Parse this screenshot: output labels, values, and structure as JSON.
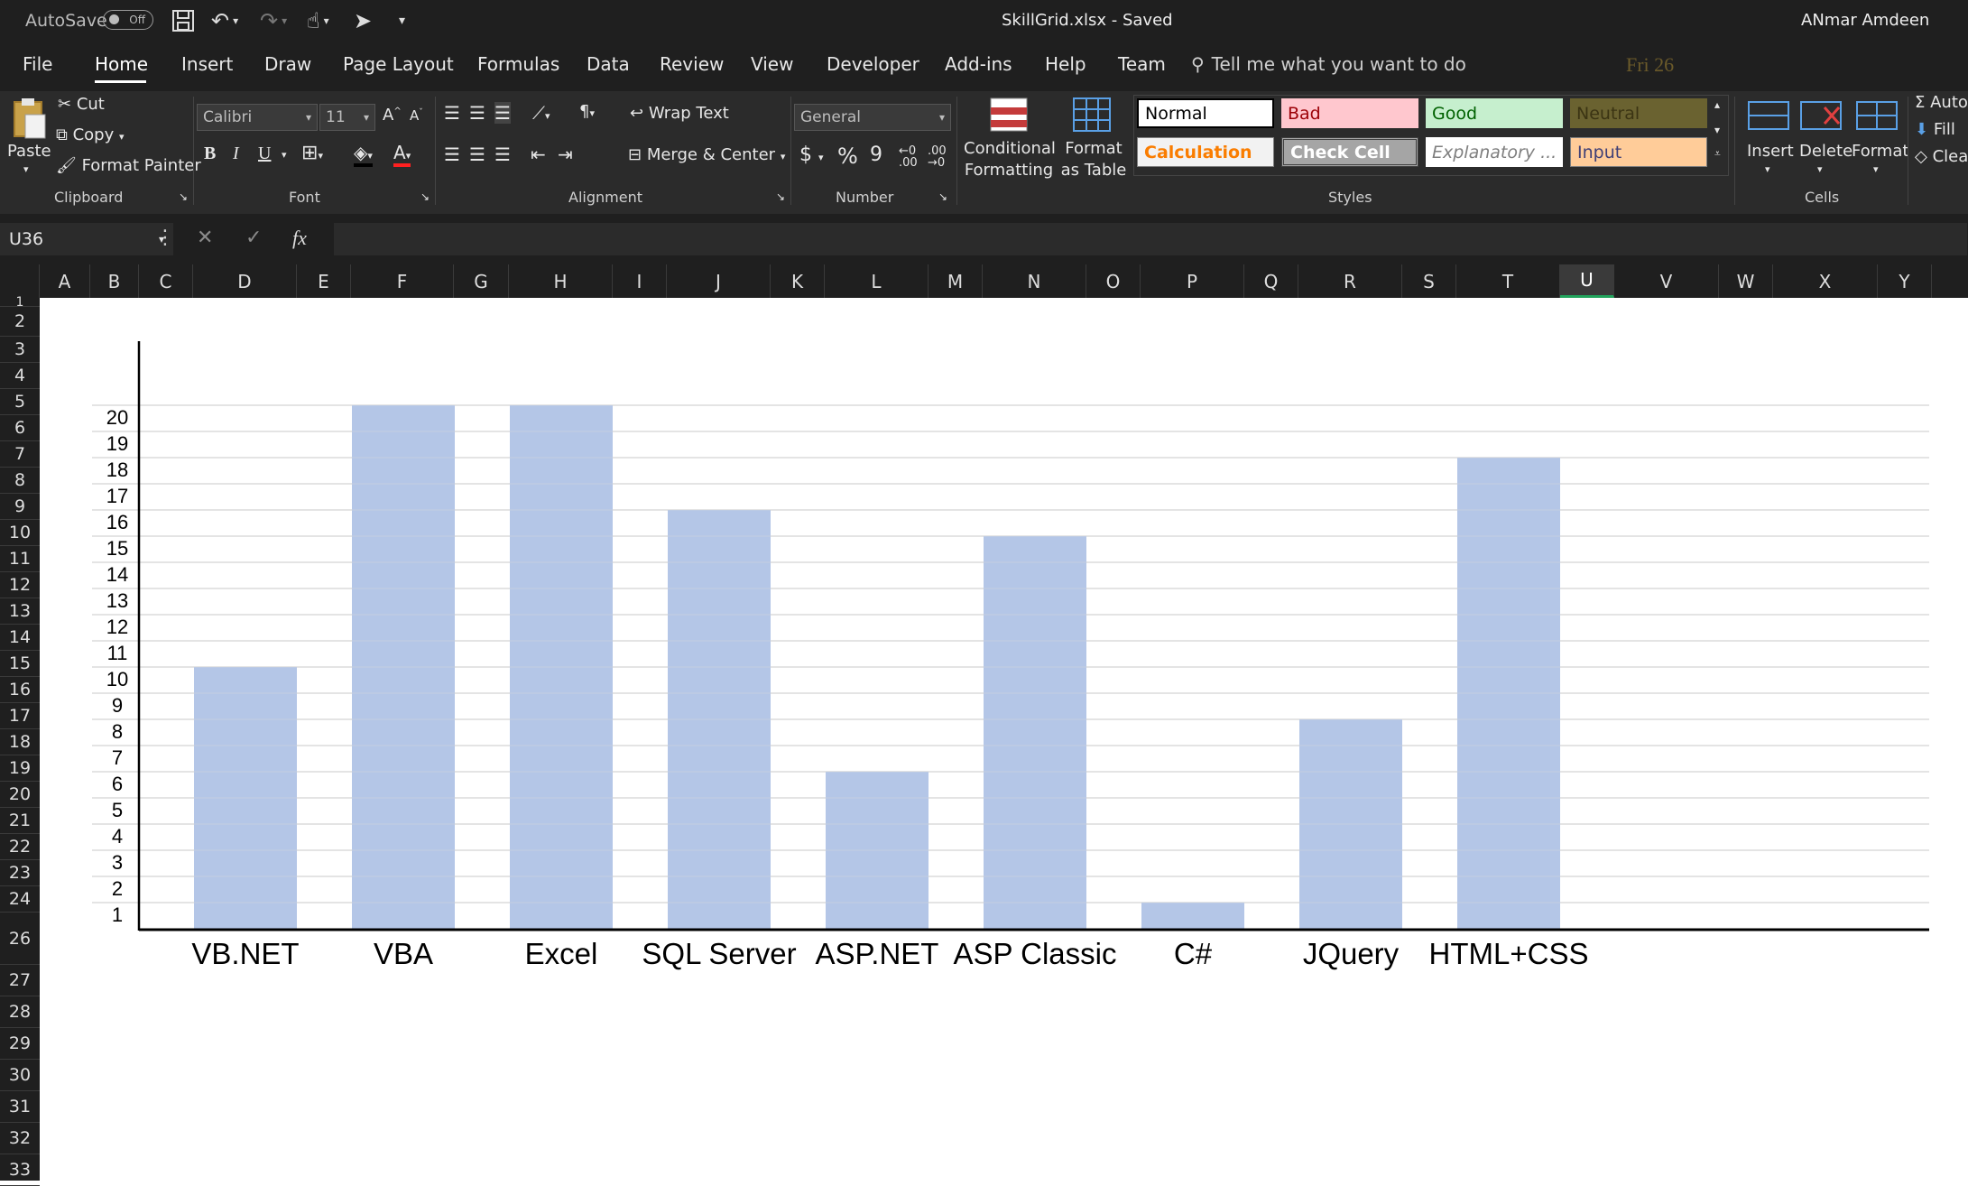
{
  "app": {
    "autosave_label": "AutoSave",
    "autosave_state": "Off",
    "doc_title": "SkillGrid.xlsx  -  Saved",
    "user": "ANmar Amdeen"
  },
  "tabs": [
    "File",
    "Home",
    "Insert",
    "Draw",
    "Page Layout",
    "Formulas",
    "Data",
    "Review",
    "View",
    "Developer",
    "Add-ins",
    "Help",
    "Team"
  ],
  "tell_me": "Tell me what you want to do",
  "ribbon": {
    "clipboard": {
      "paste": "Paste",
      "cut": "Cut",
      "copy": "Copy",
      "format_painter": "Format Painter",
      "label": "Clipboard"
    },
    "font": {
      "name": "Calibri",
      "size": "11",
      "label": "Font",
      "bold": "B",
      "italic": "I",
      "underline": "U"
    },
    "alignment": {
      "wrap_text": "Wrap Text",
      "merge_center": "Merge & Center",
      "label": "Alignment"
    },
    "number": {
      "format": "General",
      "label": "Number",
      "currency": "$",
      "percent": "%",
      "comma": "9"
    },
    "styles": {
      "conditional_formatting": "Conditional Formatting",
      "format_as_table": "Format as Table",
      "label": "Styles",
      "cells": {
        "normal": "Normal",
        "bad": "Bad",
        "good": "Good",
        "neutral": "Neutral",
        "calculation": "Calculation",
        "check_cell": "Check Cell",
        "explanatory": "Explanatory ...",
        "input": "Input"
      }
    },
    "cells": {
      "insert": "Insert",
      "delete": "Delete",
      "format": "Format",
      "label": "Cells"
    },
    "editing": {
      "autosum": "Auto",
      "fill": "Fill",
      "clear": "Clea"
    }
  },
  "formula_bar": {
    "name_box": "U36",
    "cancel": "✕",
    "enter": "✓",
    "fx": "fx",
    "value": ""
  },
  "columns": [
    "A",
    "B",
    "C",
    "D",
    "E",
    "F",
    "G",
    "H",
    "I",
    "J",
    "K",
    "L",
    "M",
    "N",
    "O",
    "P",
    "Q",
    "R",
    "S",
    "T",
    "U",
    "V",
    "W",
    "X",
    "Y"
  ],
  "selected_column": "U",
  "rows": [
    "1",
    "2",
    "3",
    "4",
    "5",
    "6",
    "7",
    "8",
    "9",
    "10",
    "11",
    "12",
    "13",
    "14",
    "15",
    "16",
    "17",
    "18",
    "19",
    "20",
    "21",
    "22",
    "23",
    "24",
    "26",
    "27",
    "28",
    "29",
    "30",
    "31",
    "32",
    "33"
  ],
  "overlay_text": "Fri 26",
  "colors": {
    "bar": "#b4c6e7",
    "ribbon_bg": "#2b2b2b",
    "title_bg": "#1f1f1f",
    "accent_select": "#22a45d"
  },
  "chart_data": {
    "type": "bar",
    "categories": [
      "VB.NET",
      "VBA",
      "Excel",
      "SQL Server",
      "ASP.NET",
      "ASP Classic",
      "C#",
      "JQuery",
      "HTML+CSS"
    ],
    "values": [
      10,
      20,
      20,
      16,
      6,
      15,
      1,
      8,
      18
    ],
    "y_ticks": [
      "1",
      "2",
      "3",
      "4",
      "5",
      "6",
      "7",
      "8",
      "9",
      "10",
      "11",
      "12",
      "13",
      "14",
      "15",
      "16",
      "17",
      "18",
      "19",
      "20"
    ],
    "ylim": [
      0,
      20
    ],
    "grid": true,
    "legend": "none"
  }
}
